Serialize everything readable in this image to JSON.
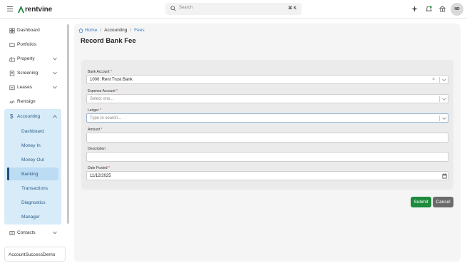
{
  "topbar": {
    "brand": "rentvine",
    "search_placeholder": "Search",
    "shortcut": "⌘ K",
    "avatar_initials": "ND"
  },
  "sidebar": {
    "items": [
      {
        "label": "Dashboard",
        "icon": "dashboard-icon"
      },
      {
        "label": "Portfolios",
        "icon": "folder-icon"
      },
      {
        "label": "Property",
        "icon": "property-icon",
        "expandable": true
      },
      {
        "label": "Screening",
        "icon": "screening-icon",
        "expandable": true
      },
      {
        "label": "Leases",
        "icon": "leases-icon",
        "expandable": true
      },
      {
        "label": "Rentsign",
        "icon": "signature-icon"
      },
      {
        "label": "Accounting",
        "icon": "dollar-icon",
        "expanded": true
      },
      {
        "label": "Contacts",
        "icon": "contacts-icon",
        "expandable": true
      }
    ],
    "accounting_sub": [
      "Dashboard",
      "Money In",
      "Money Out",
      "Banking",
      "Transactions",
      "Diagnostics",
      "Manager"
    ],
    "active_sub": "Banking",
    "account_name": "AccountSuccessDemo"
  },
  "breadcrumb": {
    "home": "Home",
    "accounting": "Accounting",
    "fees": "Fees"
  },
  "page": {
    "title": "Record Bank Fee"
  },
  "form": {
    "bank_account": {
      "label": "Bank Account",
      "value": "1000: Rent Trust Bank"
    },
    "expense_account": {
      "label": "Expense Account",
      "placeholder": "Select one..."
    },
    "ledger": {
      "label": "Ledger",
      "placeholder": "Type to search..."
    },
    "amount": {
      "label": "Amount",
      "value": ""
    },
    "description": {
      "label": "Description",
      "value": ""
    },
    "date_posted": {
      "label": "Date Posted",
      "value": "11/12/2025"
    },
    "required_mark": "*",
    "clear_glyph": "×"
  },
  "actions": {
    "submit": "Submit",
    "cancel": "Cancel"
  },
  "colors": {
    "accent": "#1e8a3c",
    "nav_active_bg": "#d7ebf9",
    "link": "#3a7bbf"
  }
}
